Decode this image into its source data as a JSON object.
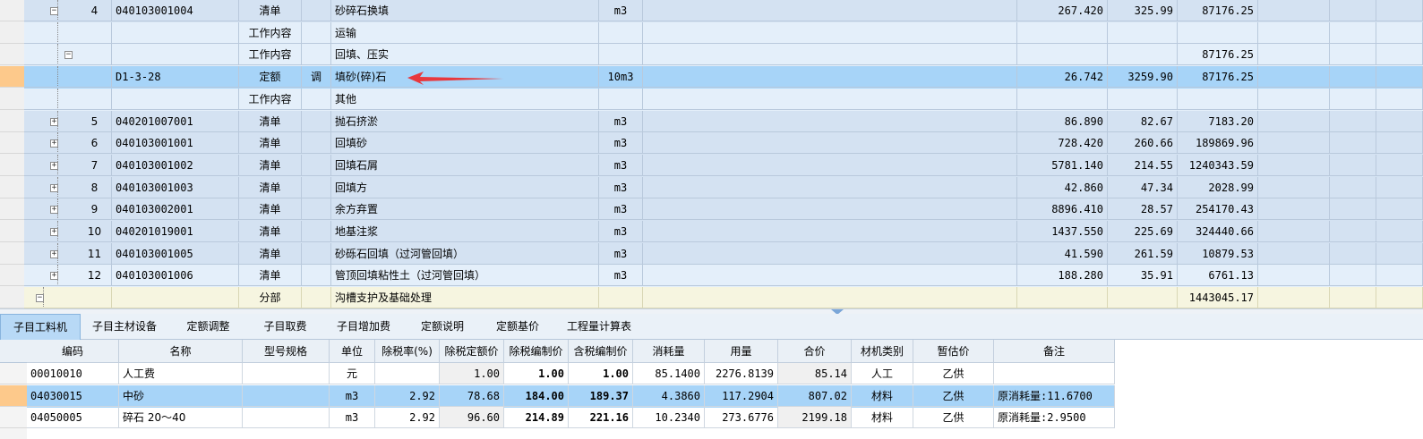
{
  "top_rows": [
    {
      "kind": "qd",
      "toggle": "−",
      "seq": "4",
      "code": "040103001004",
      "type": "清单",
      "adj": "",
      "name": "砂碎石换填",
      "unit": "m3",
      "qty": "267.420",
      "price": "325.99",
      "total": "87176.25"
    },
    {
      "kind": "sub",
      "toggle": "",
      "seq": "",
      "code": "",
      "type": "工作内容",
      "adj": "",
      "name": "运输",
      "unit": "",
      "qty": "",
      "price": "",
      "total": ""
    },
    {
      "kind": "sub",
      "toggle": "−",
      "seq": "",
      "code": "",
      "type": "工作内容",
      "adj": "",
      "name": "回填、压实",
      "unit": "",
      "qty": "",
      "price": "",
      "total": "87176.25"
    },
    {
      "kind": "de",
      "toggle": "",
      "seq": "",
      "code": "D1-3-28",
      "type": "定额",
      "adj": "调",
      "name": "填砂(碎)石",
      "unit": "10m3",
      "qty": "26.742",
      "price": "3259.90",
      "total": "87176.25"
    },
    {
      "kind": "sub",
      "toggle": "",
      "seq": "",
      "code": "",
      "type": "工作内容",
      "adj": "",
      "name": "其他",
      "unit": "",
      "qty": "",
      "price": "",
      "total": ""
    },
    {
      "kind": "qd",
      "toggle": "+",
      "seq": "5",
      "code": "040201007001",
      "type": "清单",
      "adj": "",
      "name": "抛石挤淤",
      "unit": "m3",
      "qty": "86.890",
      "price": "82.67",
      "total": "7183.20"
    },
    {
      "kind": "qd",
      "toggle": "+",
      "seq": "6",
      "code": "040103001001",
      "type": "清单",
      "adj": "",
      "name": "回填砂",
      "unit": "m3",
      "qty": "728.420",
      "price": "260.66",
      "total": "189869.96"
    },
    {
      "kind": "qd",
      "toggle": "+",
      "seq": "7",
      "code": "040103001002",
      "type": "清单",
      "adj": "",
      "name": "回填石屑",
      "unit": "m3",
      "qty": "5781.140",
      "price": "214.55",
      "total": "1240343.59"
    },
    {
      "kind": "qd",
      "toggle": "+",
      "seq": "8",
      "code": "040103001003",
      "type": "清单",
      "adj": "",
      "name": "回填方",
      "unit": "m3",
      "qty": "42.860",
      "price": "47.34",
      "total": "2028.99"
    },
    {
      "kind": "qd",
      "toggle": "+",
      "seq": "9",
      "code": "040103002001",
      "type": "清单",
      "adj": "",
      "name": "余方弃置",
      "unit": "m3",
      "qty": "8896.410",
      "price": "28.57",
      "total": "254170.43"
    },
    {
      "kind": "qd",
      "toggle": "+",
      "seq": "10",
      "code": "040201019001",
      "type": "清单",
      "adj": "",
      "name": "地基注浆",
      "unit": "m3",
      "qty": "1437.550",
      "price": "225.69",
      "total": "324440.66"
    },
    {
      "kind": "qd",
      "toggle": "+",
      "seq": "11",
      "code": "040103001005",
      "type": "清单",
      "adj": "",
      "name": "砂砾石回填（过河管回填）",
      "unit": "m3",
      "qty": "41.590",
      "price": "261.59",
      "total": "10879.53"
    },
    {
      "kind": "qdl",
      "toggle": "+",
      "seq": "12",
      "code": "040103001006",
      "type": "清单",
      "adj": "",
      "name": "管顶回填粘性土（过河管回填）",
      "unit": "m3",
      "qty": "188.280",
      "price": "35.91",
      "total": "6761.13"
    },
    {
      "kind": "fb",
      "toggle": "−",
      "seq": "",
      "code": "",
      "type": "分部",
      "adj": "",
      "name": "沟槽支护及基础处理",
      "unit": "",
      "qty": "",
      "price": "",
      "total": "1443045.17"
    }
  ],
  "tabs": [
    "子目工料机",
    "子目主材设备",
    "定额调整",
    "子目取费",
    "子目增加费",
    "定额说明",
    "定额基价",
    "工程量计算表"
  ],
  "active_tab": 0,
  "bottom_headers": [
    "编码",
    "名称",
    "型号规格",
    "单位",
    "除税率(%)",
    "除税定额价",
    "除税编制价",
    "含税编制价",
    "消耗量",
    "用量",
    "合价",
    "材机类别",
    "暂估价",
    "备注"
  ],
  "bottom_rows": [
    {
      "sel": false,
      "code": "00010010",
      "name": "人工费",
      "spec": "",
      "unit": "元",
      "rate": "",
      "base": "1.00",
      "price": "1.00",
      "taxprice": "1.00",
      "consume": "85.1400",
      "usage": "2276.8139",
      "total": "85.14",
      "cat": "人工",
      "est": "乙供",
      "note": ""
    },
    {
      "sel": true,
      "code": "04030015",
      "name": "中砂",
      "spec": "",
      "unit": "m3",
      "rate": "2.92",
      "base": "78.68",
      "price": "184.00",
      "taxprice": "189.37",
      "consume": "4.3860",
      "usage": "117.2904",
      "total": "807.02",
      "cat": "材料",
      "est": "乙供",
      "note": "原消耗量:11.6700"
    },
    {
      "sel": false,
      "code": "04050005",
      "name": "碎石 20～40",
      "spec": "",
      "unit": "m3",
      "rate": "2.92",
      "base": "96.60",
      "price": "214.89",
      "taxprice": "221.16",
      "consume": "10.2340",
      "usage": "273.6776",
      "total": "2199.18",
      "cat": "材料",
      "est": "乙供",
      "note": "原消耗量:2.9500"
    }
  ],
  "colors": {
    "qd": "#d4e2f2",
    "dinge_selected": "#a7d4f8",
    "fenbu": "#f6f5e0",
    "arrow": "#e8383d",
    "row_marker": "#fdc98b"
  }
}
